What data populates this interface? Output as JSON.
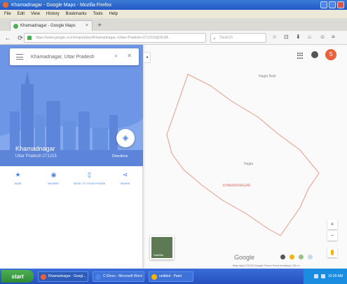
{
  "window": {
    "title": "Khamadnagar - Google Maps - Mozilla Firefox"
  },
  "menubar": {
    "items": [
      "File",
      "Edit",
      "View",
      "History",
      "Bookmarks",
      "Tools",
      "Help"
    ]
  },
  "tab": {
    "title": "Khamadnagar - Google Maps",
    "close": "×",
    "new_tab": "+"
  },
  "navbar": {
    "back": "←",
    "reload": "⟳",
    "url": "https://www.google.co.in/maps/place/Khamadnagar,+Uttar+Pradesh+271215/@26.84...",
    "search_placeholder": "Search"
  },
  "toolbar_icons": [
    "☆",
    "⊡",
    "⬇",
    "⌂",
    "☺",
    "≡"
  ],
  "maps": {
    "search_value": "Khamadnagar, Uttar Pradesh",
    "place_name": "Khamadnagar",
    "place_subtitle": "Uttar Pradesh 271215",
    "directions_label": "Directions",
    "collapse": "◂",
    "actions": [
      {
        "icon": "★",
        "label": "SAVE"
      },
      {
        "icon": "◉",
        "label": "NEARBY"
      },
      {
        "icon": "▯",
        "label": "SEND TO YOUR PHONE"
      },
      {
        "icon": "⋖",
        "label": "SHARE"
      }
    ],
    "map_labels": {
      "north": "Nagla Badi",
      "center": "Nagla",
      "area": "KHAMADNAGAR"
    },
    "avatar_letter": "S",
    "satellite_label": "Satellite",
    "zoom_in": "+",
    "zoom_out": "−",
    "google_logo": "Google",
    "footer": "Map data ©2018 Google   Terms   Send feedback   200 m"
  },
  "taskbar": {
    "start_label": "start",
    "tasks": [
      {
        "label": "Khamadnagar - Googl...",
        "color": "#e8613a"
      },
      {
        "label": "C:\\Docs - Microsoft Word",
        "color": "#4a86e8"
      },
      {
        "label": "untitled - Paint",
        "color": "#f4b400"
      }
    ],
    "clock": "10:39 AM"
  },
  "colors": {
    "accent": "#4a80e8",
    "hero": "#6e96e6",
    "boundary": "#e89a88",
    "avatar": "#e8613a"
  }
}
